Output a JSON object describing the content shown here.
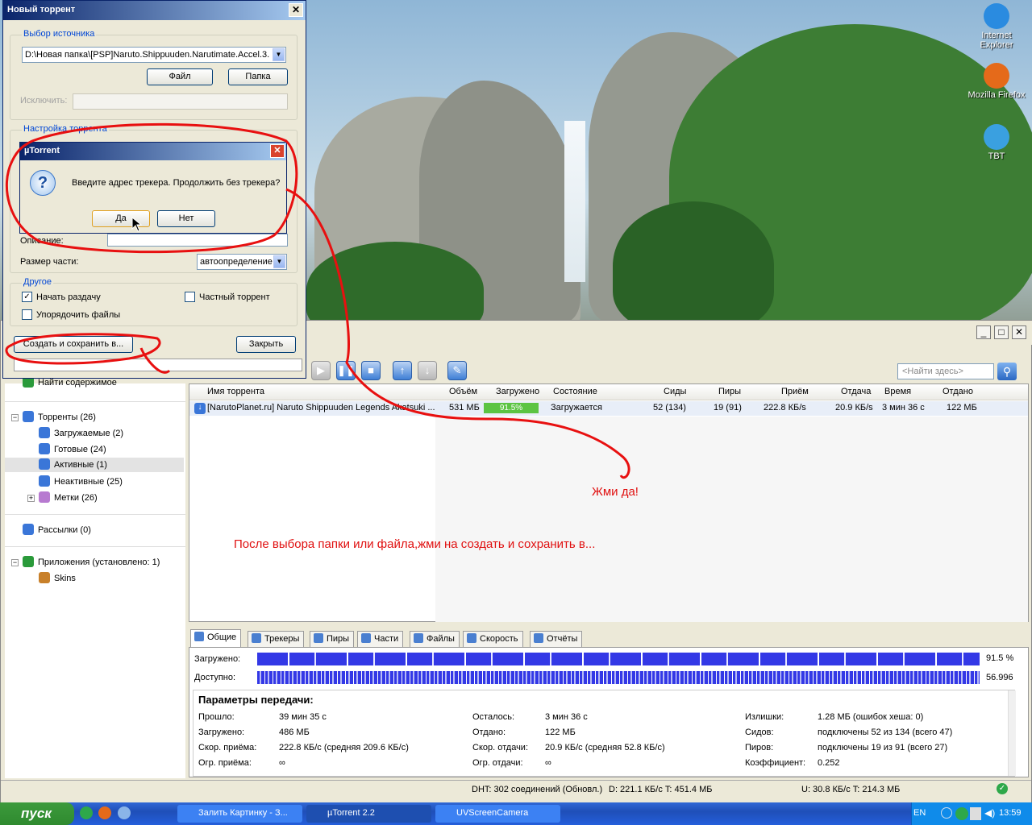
{
  "desktop": {
    "icons": [
      {
        "label": "Internet Explorer",
        "color": "#2a8be0"
      },
      {
        "label": "Mozilla Firefox",
        "color": "#e56a1a"
      },
      {
        "label": "TBT",
        "color": "#3aa0e0"
      }
    ]
  },
  "utorrent": {
    "search_placeholder": "<Найти здесь>",
    "sidebar": {
      "find_content": "Найти содержимое",
      "torrents": "Торренты (26)",
      "downloading": "Загружаемые (2)",
      "completed": "Готовые (24)",
      "active": "Активные (1)",
      "inactive": "Неактивные (25)",
      "labels": "Метки (26)",
      "feeds": "Рассылки (0)",
      "apps": "Приложения (установлено: 1)",
      "skins": "Skins"
    },
    "columns": [
      "Имя торрента",
      "Объём",
      "Загружено",
      "Состояние",
      "Сиды",
      "Пиры",
      "Приём",
      "Отдача",
      "Время",
      "Отдано"
    ],
    "rows": [
      {
        "name": "[NarutoPlanet.ru] Naruto Shippuuden Legends Akatsuki ...",
        "size": "531 МБ",
        "done": "91.5%",
        "done_fraction": 0.915,
        "status": "Загружается",
        "seeds": "52 (134)",
        "peers": "19 (91)",
        "down": "222.8 КБ/s",
        "up": "20.9 КБ/s",
        "eta": "3 мин 36 с",
        "uploaded": "122 МБ"
      }
    ],
    "tabs": [
      "Общие",
      "Трекеры",
      "Пиры",
      "Части",
      "Файлы",
      "Скорость",
      "Отчёты"
    ],
    "detail": {
      "downloaded_label": "Загружено:",
      "downloaded_value": "91.5 %",
      "available_label": "Доступно:",
      "available_value": "56.996",
      "params_title": "Параметры передачи:",
      "params": [
        [
          "Прошло:",
          "39 мин 35 с",
          "Осталось:",
          "3 мин 36 с",
          "Излишки:",
          "1.28 МБ (ошибок хеша: 0)"
        ],
        [
          "Загружено:",
          "486 МБ",
          "Отдано:",
          "122 МБ",
          "Сидов:",
          "подключены 52 из 134 (всего 47)"
        ],
        [
          "Скор. приёма:",
          "222.8 КБ/с (средняя 209.6 КБ/с)",
          "Скор. отдачи:",
          "20.9 КБ/с (средняя 52.8 КБ/с)",
          "Пиров:",
          "подключены 19 из 91 (всего 27)"
        ],
        [
          "Огр. приёма:",
          "∞",
          "Огр. отдачи:",
          "∞",
          "Коэффициент:",
          "0.252"
        ]
      ]
    },
    "status": {
      "dht": "DHT: 302 соединений  (Обновл.)",
      "download": "D: 221.1 КБ/с T: 451.4 МБ",
      "upload": "U: 30.8 КБ/с T: 214.3 МБ"
    }
  },
  "new_torrent": {
    "title": "Новый торрент",
    "source_group": "Выбор источника",
    "source_path": "D:\\Новая папка\\[PSP]Naruto.Shippuuden.Narutimate.Accel.3.",
    "file_btn": "Файл",
    "folder_btn": "Папка",
    "exclude_label": "Исключить:",
    "settings_group": "Настройка торрента",
    "description_label": "Описание:",
    "piece_size_label": "Размер части:",
    "piece_size_value": "автоопределение",
    "other_group": "Другое",
    "start_seeding": "Начать раздачу",
    "private_torrent": "Частный торрент",
    "preserve_order": "Упорядочить файлы",
    "create_btn": "Создать и сохранить в...",
    "close_btn": "Закрыть"
  },
  "message_box": {
    "title": "µTorrent",
    "text": "Введите адрес трекера. Продолжить без трекера?",
    "yes": "Да",
    "no": "Нет"
  },
  "annotations": {
    "press_yes": "Жми да!",
    "instruction": "После выбора папки или файла,жми на создать и сохранить в..."
  },
  "taskbar": {
    "start": "пуск",
    "tasks": [
      "Залить Картинку - З...",
      "µTorrent 2.2",
      "UVScreenCamera"
    ],
    "lang": "EN",
    "clock": "13:59"
  }
}
